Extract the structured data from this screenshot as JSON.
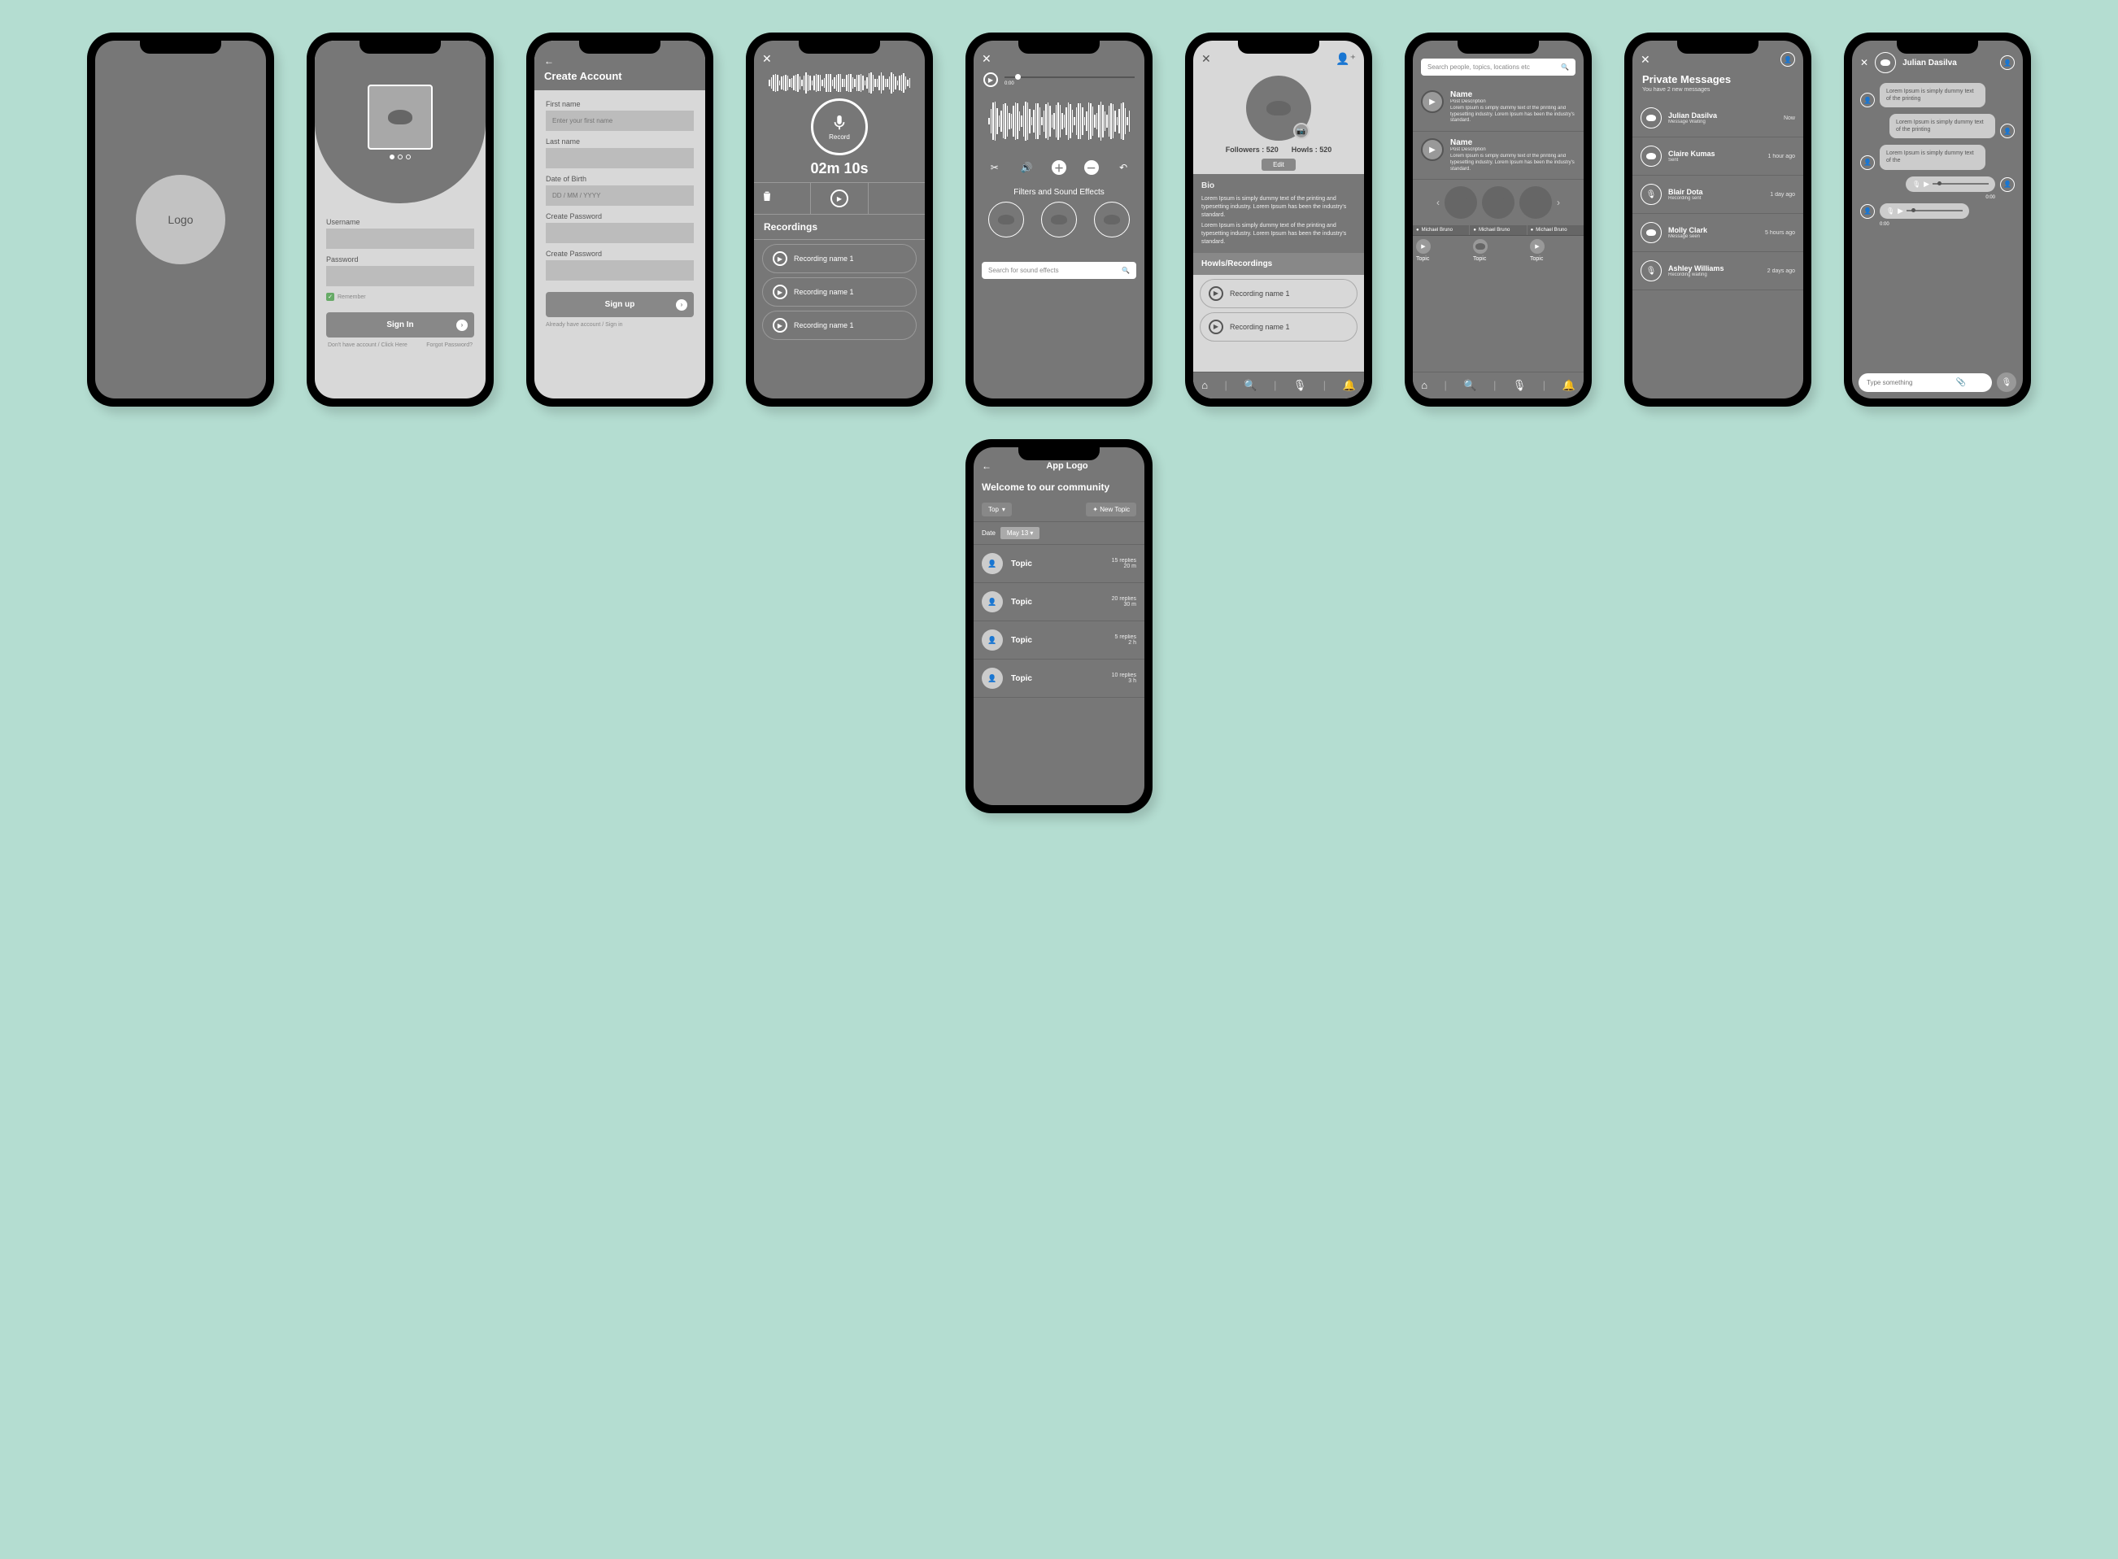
{
  "s1": {
    "logo": "Logo"
  },
  "s2": {
    "username": "Username",
    "password": "Password",
    "remember": "Remember",
    "signin": "Sign In",
    "noacct": "Don't have account / Click Here",
    "forgot": "Forgot Password?"
  },
  "s3": {
    "title": "Create Account",
    "first": "First name",
    "first_ph": "Enter your first name",
    "last": "Last name",
    "dob": "Date of Birth",
    "dob_ph": "DD / MM / YYYY",
    "pw1": "Create Password",
    "pw2": "Create Password",
    "signup": "Sign up",
    "already": "Already have account / Sign in"
  },
  "s4": {
    "record": "Record",
    "timer": "02m 10s",
    "head": "Recordings",
    "r1": "Recording name 1",
    "r2": "Recording name 1",
    "r3": "Recording name 1"
  },
  "s5": {
    "time": "0:00",
    "fx": "Filters and Sound Effects",
    "search": "Search for sound effects"
  },
  "s6": {
    "followers": "Followers : 520",
    "howls": "Howls : 520",
    "edit": "Edit",
    "bio": "Bio",
    "lorem1": "Lorem Ipsum is simply dummy text of the printing and typesetting industry. Lorem Ipsum has been the industry's standard.",
    "lorem2": "Lorem Ipsum is simply dummy text of the printing and typesetting industry. Lorem Ipsum has been the industry's standard.",
    "sec": "Howls/Recordings",
    "r1": "Recording name 1",
    "r2": "Recording name 1"
  },
  "s7": {
    "search": "Search people, topics, locations etc",
    "name": "Name",
    "subt": "Post Description",
    "lorem": "Lorem Ipsum is simply dummy text of the printing and typesetting industry. Lorem Ipsum has been the industry's standard.",
    "mb": "Michael Bruno",
    "topic": "Topic"
  },
  "s8": {
    "title": "Private Messages",
    "sub": "You have 2 new messages",
    "m": [
      {
        "n": "Julian Dasilva",
        "s": "Message Waiting",
        "t": "Now",
        "ic": "cloud"
      },
      {
        "n": "Claire Kumas",
        "s": "Sent",
        "t": "1 hour ago",
        "ic": "cloud"
      },
      {
        "n": "Blair Dota",
        "s": "Recording sent",
        "t": "1 day ago",
        "ic": "mic"
      },
      {
        "n": "Molly Clark",
        "s": "Message seen",
        "t": "5 hours ago",
        "ic": "cloud"
      },
      {
        "n": "Ashley Williams",
        "s": "Recording waiting",
        "t": "2 days ago",
        "ic": "mic"
      }
    ]
  },
  "s9": {
    "name": "Julian Dasilva",
    "b1": "Lorem Ipsum is simply dummy text of the printing",
    "b2": "Lorem Ipsum is simply dummy text of the printing",
    "b3": "Lorem Ipsum is simply dummy text of the",
    "t": "0:00",
    "ph": "Type something"
  },
  "s10": {
    "brand": "App Logo",
    "welcome": "Welcome to our community",
    "top": "Top",
    "new": "New Topic",
    "date": "Date",
    "dval": "May 13",
    "items": [
      {
        "t": "Topic",
        "r": "15 replies",
        "d": "20 m"
      },
      {
        "t": "Topic",
        "r": "20 replies",
        "d": "30 m"
      },
      {
        "t": "Topic",
        "r": "5 replies",
        "d": "2 h"
      },
      {
        "t": "Topic",
        "r": "10 replies",
        "d": "3 h"
      }
    ]
  }
}
